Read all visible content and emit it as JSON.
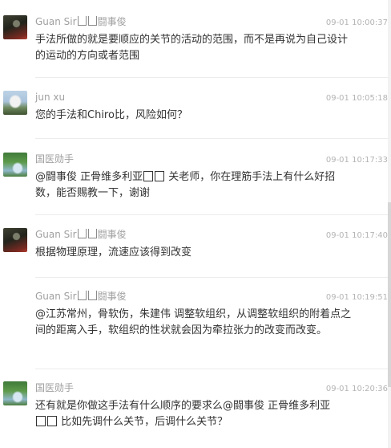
{
  "comments": [
    {
      "author_prefix": "Guan Sir",
      "author_suffix": "闘事俊",
      "time": "09-01 10:00:37",
      "text": "手法所做的就是要顺应的关节的活动的范围，而不是再说为自己设计的运动的方向或者范围",
      "avatar_icon": "avatar-dark-figure"
    },
    {
      "author": "jun xu",
      "time": "09-01 10:05:18",
      "text": "您的手法和Chiro比，风险如何？",
      "avatar_icon": "avatar-bird"
    },
    {
      "author": "国医勋手",
      "time": "09-01 10:17:33",
      "text_before": "@闘事俊 正骨维多利亚",
      "text_after": " 关老师，你在理筋手法上有什么好招数，能否赐教一下，谢谢",
      "avatar_icon": "avatar-landscape"
    },
    {
      "author_prefix": "Guan Sir",
      "author_suffix": "闘事俊",
      "time": "09-01 10:17:40",
      "text": "根据物理原理，流速应该得到改变",
      "avatar_icon": "avatar-dark-figure"
    },
    {
      "author_prefix": "Guan Sir",
      "author_suffix": "闘事俊",
      "time": "09-01 10:19:51",
      "text": "@江苏常州，骨软伤，朱建伟 调整软组织，从调整软组织的附着点之间的距离入手，软组织的性状就会因为牵拉张力的改变而改变。"
    },
    {
      "author": "国医勋手",
      "time": "09-01 10:20:36",
      "text_before": "还有就是你做这手法有什么顺序的要求么@闘事俊 正骨维多利亚",
      "text_after": " 比如先调什么关节，后调什么关节？",
      "avatar_icon": "avatar-landscape"
    }
  ]
}
